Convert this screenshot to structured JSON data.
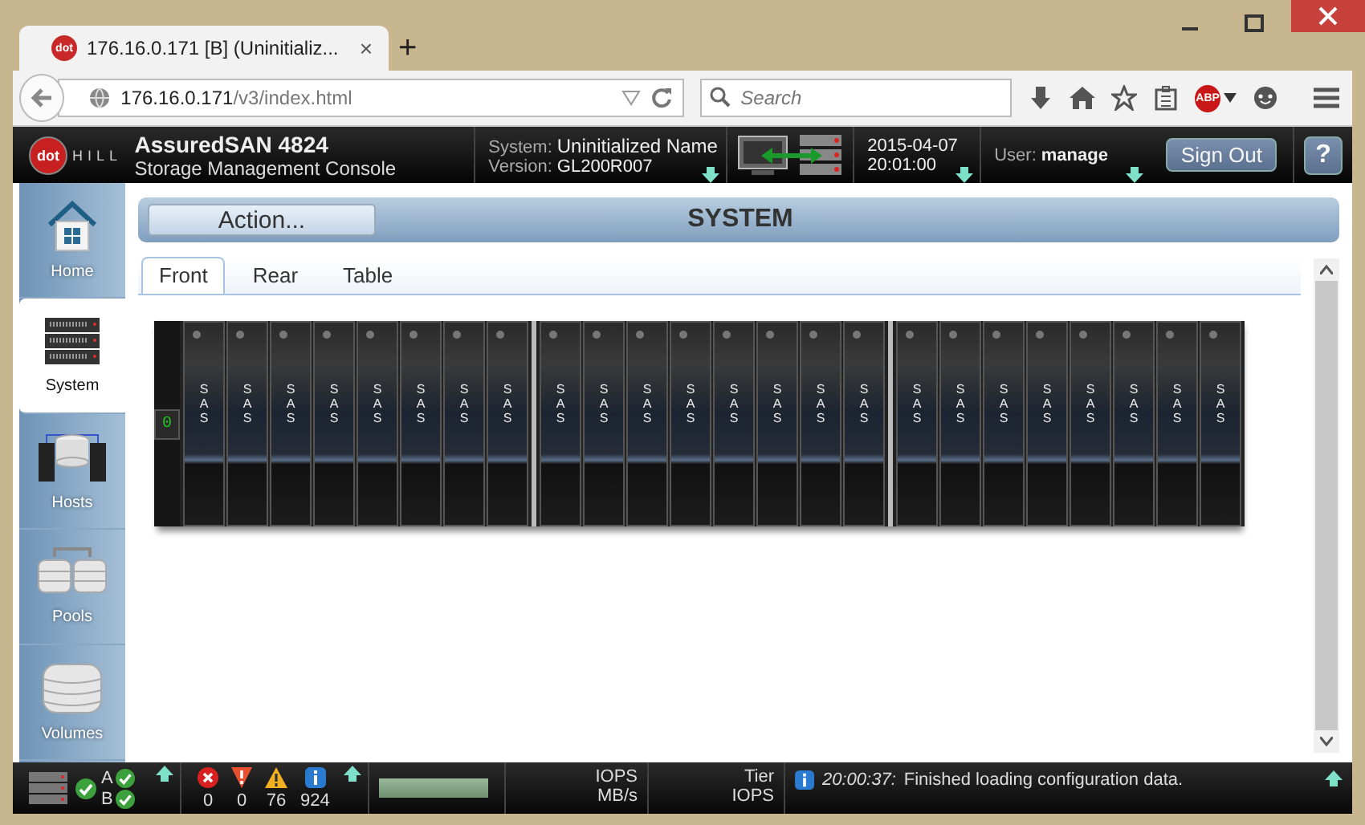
{
  "browser": {
    "favicon_text": "dot",
    "tab_title": "176.16.0.171 [B] (Uninitializ...",
    "close_tab": "×",
    "new_tab": "+",
    "url_host": "176.16.0.171",
    "url_path": "/v3/index.html",
    "search_placeholder": "Search",
    "adblock": "ABP"
  },
  "header": {
    "logo_left": "dot",
    "logo_right": "HILL",
    "product": "AssuredSAN 4824",
    "subtitle": "Storage Management Console",
    "system_label": "System:",
    "system_name": "Uninitialized Name",
    "version_label": "Version:",
    "version": "GL200R007",
    "date": "2015-04-07",
    "time": "20:01:00",
    "user_label": "User:",
    "user": "manage",
    "sign_out": "Sign Out",
    "help": "?"
  },
  "sidebar": {
    "items": [
      {
        "kind": "home",
        "label": "Home",
        "selected": false
      },
      {
        "kind": "system",
        "label": "System",
        "selected": true
      },
      {
        "kind": "hosts",
        "label": "Hosts",
        "selected": false
      },
      {
        "kind": "pools",
        "label": "Pools",
        "selected": false
      },
      {
        "kind": "volumes",
        "label": "Volumes",
        "selected": false
      }
    ]
  },
  "action": {
    "button": "Action...",
    "title": "SYSTEM"
  },
  "tabs": [
    {
      "label": "Front",
      "selected": true
    },
    {
      "label": "Rear",
      "selected": false
    },
    {
      "label": "Table",
      "selected": false
    }
  ],
  "enclosure": {
    "id": "0",
    "drive_groups": [
      [
        "SAS",
        "SAS",
        "SAS",
        "SAS",
        "SAS",
        "SAS",
        "SAS",
        "SAS"
      ],
      [
        "SAS",
        "SAS",
        "SAS",
        "SAS",
        "SAS",
        "SAS",
        "SAS",
        "SAS"
      ],
      [
        "SAS",
        "SAS",
        "SAS",
        "SAS",
        "SAS",
        "SAS",
        "SAS",
        "SAS"
      ]
    ]
  },
  "status_bar": {
    "controllers": [
      {
        "label": "A"
      },
      {
        "label": "B"
      }
    ],
    "alerts": [
      {
        "kind": "critical",
        "count": "0"
      },
      {
        "kind": "error",
        "count": "0"
      },
      {
        "kind": "warning",
        "count": "76"
      },
      {
        "kind": "info",
        "count": "924"
      }
    ],
    "iops_labels": [
      "IOPS",
      "MB/s"
    ],
    "tier_labels": [
      "Tier",
      "IOPS"
    ],
    "message_time": "20:00:37:",
    "message": "Finished loading configuration data."
  }
}
